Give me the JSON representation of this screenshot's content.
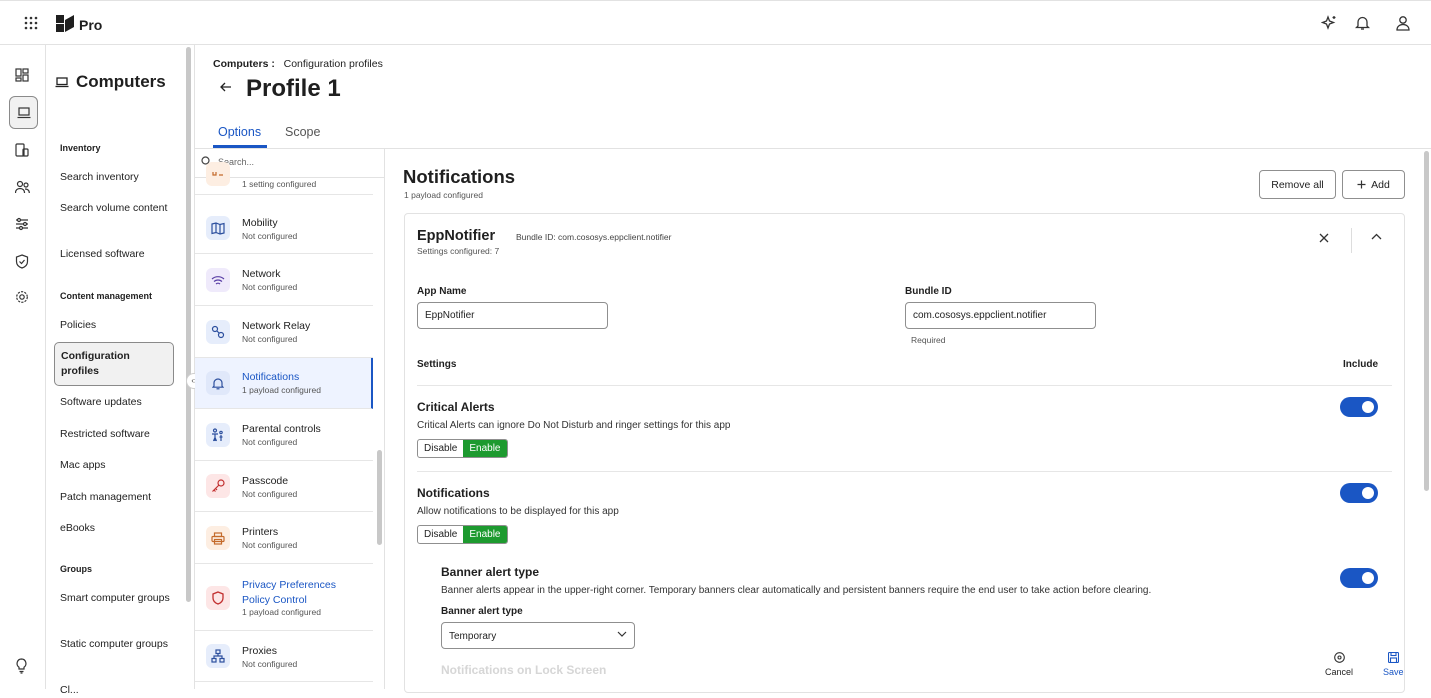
{
  "app": {
    "brand": "Pro"
  },
  "nav": {
    "title": "Computers",
    "sections": {
      "inventory": "Inventory",
      "content": "Content management",
      "groups": "Groups"
    },
    "items": {
      "search_inventory": "Search inventory",
      "search_volume": "Search volume content",
      "licensed": "Licensed software",
      "policies": "Policies",
      "config_profiles": "Configuration profiles",
      "software_updates": "Software updates",
      "restricted": "Restricted software",
      "mac_apps": "Mac apps",
      "patch": "Patch management",
      "ebooks": "eBooks",
      "smart_groups": "Smart computer groups",
      "static_groups": "Static computer groups",
      "partial": "Cl..."
    }
  },
  "header": {
    "breadcrumb_root": "Computers :",
    "breadcrumb_current": "Configuration profiles",
    "title": "Profile 1",
    "tabs": {
      "options": "Options",
      "scope": "Scope"
    }
  },
  "payloads": {
    "search_placeholder": "Search...",
    "items": [
      {
        "name": "",
        "sub": "1 setting configured"
      },
      {
        "name": "Mobility",
        "sub": "Not configured"
      },
      {
        "name": "Network",
        "sub": "Not configured"
      },
      {
        "name": "Network Relay",
        "sub": "Not configured"
      },
      {
        "name": "Notifications",
        "sub": "1 payload configured"
      },
      {
        "name": "Parental controls",
        "sub": "Not configured"
      },
      {
        "name": "Passcode",
        "sub": "Not configured"
      },
      {
        "name": "Printers",
        "sub": "Not configured"
      },
      {
        "name": "Privacy Preferences Policy Control",
        "sub": "1 payload configured"
      },
      {
        "name": "Proxies",
        "sub": "Not configured"
      }
    ]
  },
  "main": {
    "title": "Notifications",
    "subtitle": "1 payload configured",
    "remove_all": "Remove all",
    "add": "Add",
    "card": {
      "title": "EppNotifier",
      "bundle": "Bundle ID: com.cososys.eppclient.notifier",
      "settings_count": "Settings configured: 7",
      "app_name_label": "App Name",
      "app_name_value": "EppNotifier",
      "bundle_label": "Bundle ID",
      "bundle_value": "com.cososys.eppclient.notifier",
      "bundle_help": "Required",
      "settings_header": "Settings",
      "include_header": "Include",
      "disable": "Disable",
      "enable": "Enable",
      "critical_title": "Critical Alerts",
      "critical_desc": "Critical Alerts can ignore Do Not Disturb and ringer settings for this app",
      "notif_title": "Notifications",
      "notif_desc": "Allow notifications to be displayed for this app",
      "banner_title": "Banner alert type",
      "banner_desc": "Banner alerts appear in the upper-right corner. Temporary banners clear automatically and persistent banners require the end user to take action before clearing.",
      "banner_select_label": "Banner alert type",
      "banner_select_value": "Temporary",
      "faded_next": "Notifications on Lock Screen"
    },
    "footer": {
      "cancel": "Cancel",
      "save": "Save"
    }
  }
}
